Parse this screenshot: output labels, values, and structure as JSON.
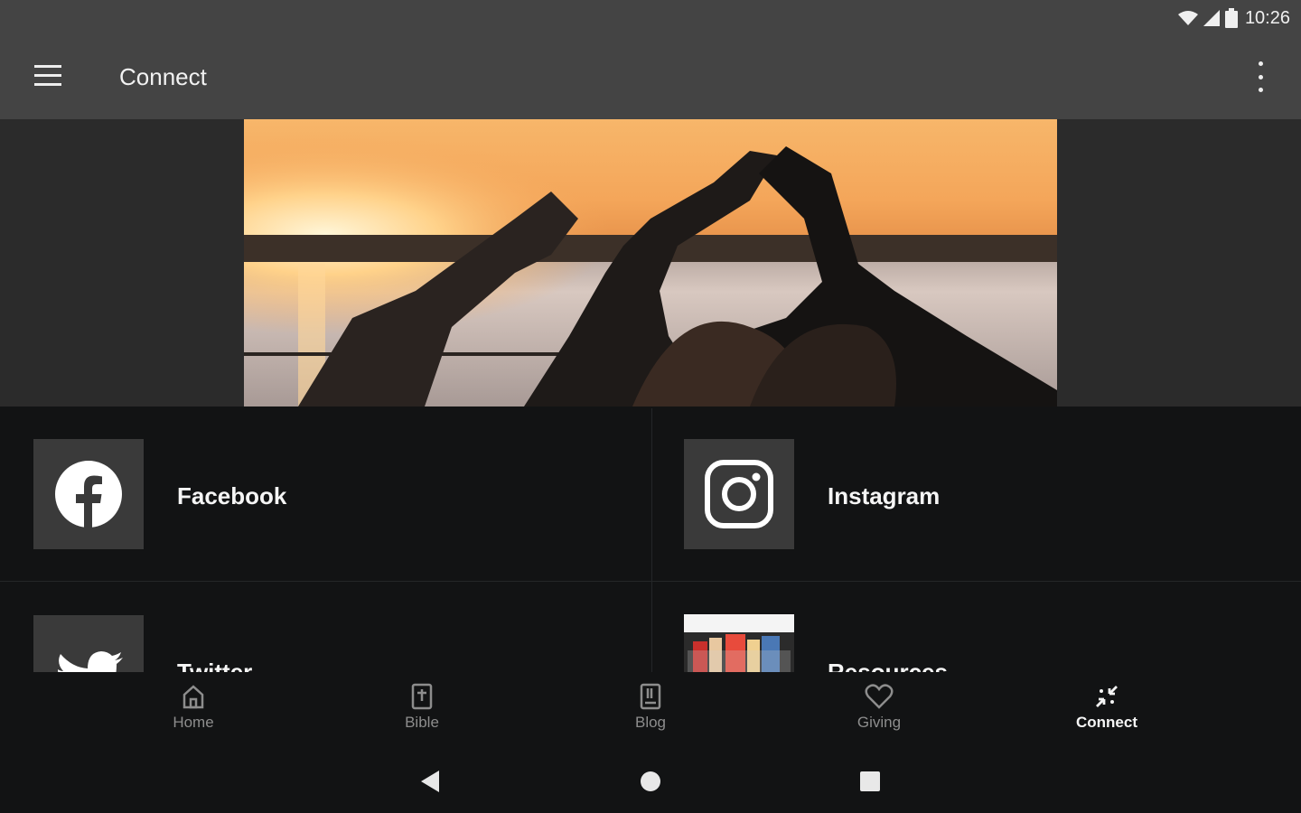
{
  "status_bar": {
    "time": "10:26",
    "icons": [
      "wifi-icon",
      "signal-icon",
      "battery-icon"
    ]
  },
  "app_bar": {
    "title": "Connect",
    "menu_icon": "hamburger-menu-icon",
    "overflow_icon": "more-vert-icon"
  },
  "tiles": [
    {
      "label": "Facebook",
      "icon": "facebook-icon"
    },
    {
      "label": "Instagram",
      "icon": "instagram-icon"
    },
    {
      "label": "Twitter",
      "icon": "twitter-icon"
    },
    {
      "label": "Resources",
      "icon": "resources-thumbnail"
    }
  ],
  "bottom_nav": {
    "items": [
      {
        "label": "Home",
        "icon": "home-icon"
      },
      {
        "label": "Bible",
        "icon": "bible-icon"
      },
      {
        "label": "Blog",
        "icon": "blog-icon"
      },
      {
        "label": "Giving",
        "icon": "heart-icon"
      },
      {
        "label": "Connect",
        "icon": "connect-icon"
      }
    ],
    "active": "Connect"
  },
  "system_nav": {
    "buttons": [
      "back-icon",
      "home-circle-icon",
      "recents-icon"
    ]
  },
  "colors": {
    "app_bar": "#444444",
    "background": "#121314",
    "tile_thumb": "#3a3a3a",
    "inactive_nav": "#8d8d8d",
    "active_nav": "#f5f5f5"
  }
}
